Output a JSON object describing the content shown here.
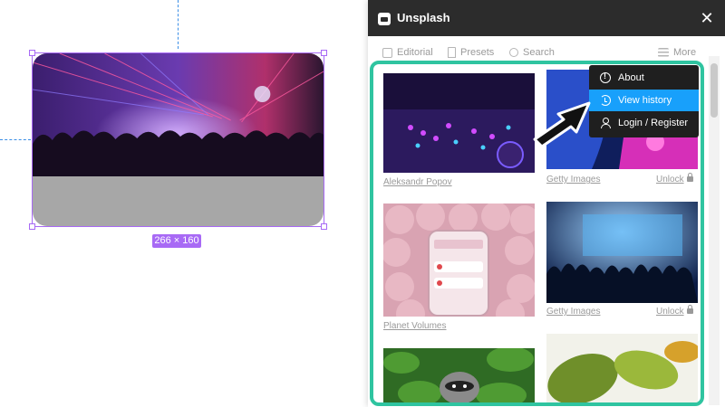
{
  "canvas": {
    "selection_size_label": "266 × 160"
  },
  "plugin": {
    "title": "Unsplash",
    "close_icon": "close-icon",
    "toolbar": {
      "editorial_label": "Editorial",
      "presets_label": "Presets",
      "search_label": "Search",
      "more_label": "More"
    },
    "grid": {
      "items": [
        {
          "credit": "Aleksandr Popov",
          "unlock": ""
        },
        {
          "credit": "Getty Images",
          "unlock": "Unlock"
        },
        {
          "credit": "Planet Volumes",
          "unlock": ""
        },
        {
          "credit": "Getty Images",
          "unlock": "Unlock"
        }
      ]
    },
    "menu": {
      "items": [
        {
          "label": "About",
          "icon": "info-icon"
        },
        {
          "label": "View history",
          "icon": "history-icon"
        },
        {
          "label": "Login / Register",
          "icon": "user-icon"
        }
      ]
    },
    "colors": {
      "highlight_border": "#2fc4a0",
      "menu_active": "#18a0fb",
      "selection": "#a86af5"
    }
  }
}
